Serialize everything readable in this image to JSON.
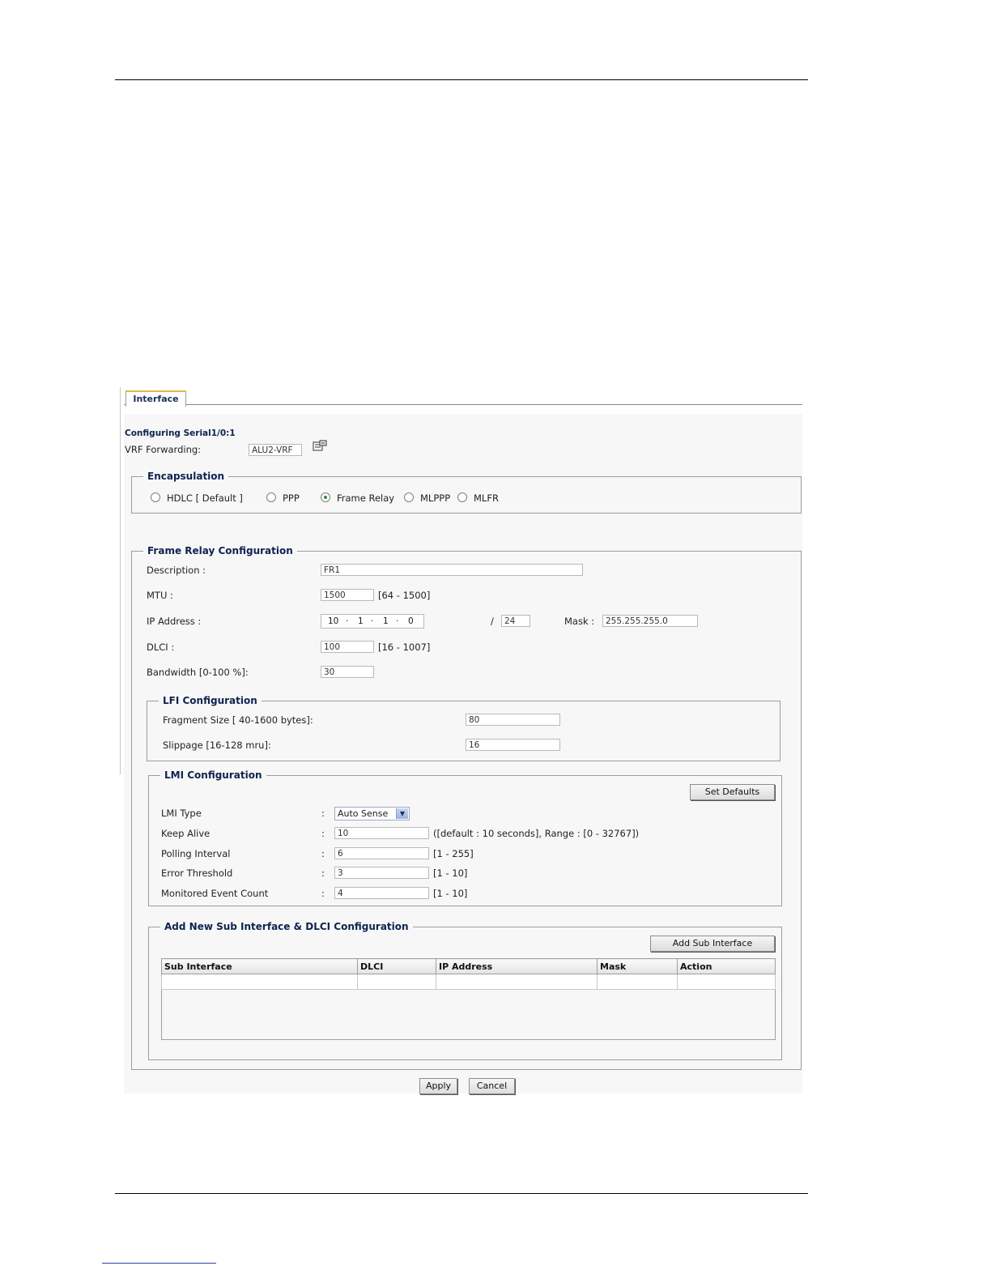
{
  "tab": {
    "label": "Interface"
  },
  "header": {
    "configuring": "Configuring  Serial1/0:1"
  },
  "vrf": {
    "label": "VRF Forwarding:",
    "value": "ALU2-VRF"
  },
  "encapsulation": {
    "legend": "Encapsulation",
    "options": [
      {
        "label": "HDLC [ Default ]",
        "selected": false
      },
      {
        "label": "PPP",
        "selected": false
      },
      {
        "label": "Frame Relay",
        "selected": true
      },
      {
        "label": "MLPPP",
        "selected": false
      },
      {
        "label": "MLFR",
        "selected": false
      }
    ]
  },
  "frame_relay": {
    "legend": "Frame Relay Configuration",
    "description": {
      "label": "Description :",
      "value": "FR1"
    },
    "mtu": {
      "label": "MTU :",
      "value": "1500",
      "hint": "[64 - 1500]"
    },
    "ip": {
      "label": "IP Address :",
      "octets": [
        "10",
        "1",
        "1",
        "0"
      ],
      "slash": "/",
      "prefix": "24",
      "mask_label": "Mask :",
      "mask": "255.255.255.0"
    },
    "dlci": {
      "label": "DLCI :",
      "value": "100",
      "hint": "[16 - 1007]"
    },
    "bandwidth": {
      "label": "Bandwidth [0-100 %]:",
      "value": "30"
    }
  },
  "lfi": {
    "legend": "LFI Configuration",
    "fragment": {
      "label": "Fragment Size [ 40-1600 bytes]:",
      "value": "80"
    },
    "slippage": {
      "label": "Slippage [16-128 mru]:",
      "value": "16"
    }
  },
  "lmi": {
    "legend": "LMI Configuration",
    "set_defaults": "Set Defaults",
    "colon": ":",
    "type": {
      "label": "LMI Type",
      "value": "Auto Sense"
    },
    "keep_alive": {
      "label": "Keep Alive",
      "value": "10",
      "hint": "([default : 10 seconds], Range : [0 - 32767])"
    },
    "polling": {
      "label": "Polling Interval",
      "value": "6",
      "hint": "[1 - 255]"
    },
    "error": {
      "label": "Error Threshold",
      "value": "3",
      "hint": "[1 - 10]"
    },
    "monitored": {
      "label": "Monitored Event Count",
      "value": "4",
      "hint": "[1 - 10]"
    }
  },
  "sub": {
    "legend": "Add New Sub Interface & DLCI Configuration",
    "add_button": "Add Sub Interface",
    "columns": [
      "Sub Interface",
      "DLCI",
      "IP Address",
      "Mask",
      "Action"
    ]
  },
  "actions": {
    "apply": "Apply",
    "cancel": "Cancel"
  }
}
